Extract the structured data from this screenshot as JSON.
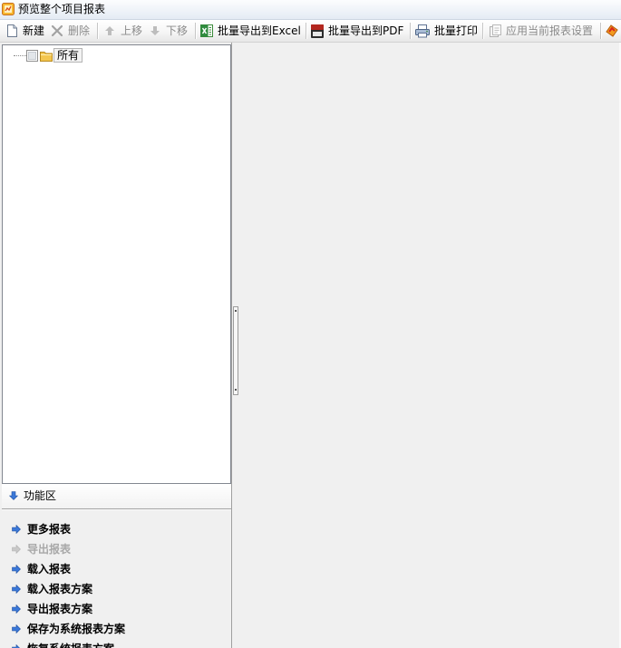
{
  "window": {
    "title": "预览整个项目报表",
    "icon": "report-app-icon"
  },
  "toolbar": {
    "buttons": [
      {
        "label": "新建",
        "icon": "new-document-icon",
        "enabled": true
      },
      {
        "label": "删除",
        "icon": "delete-icon",
        "enabled": false
      },
      {
        "label": "上移",
        "icon": "move-up-icon",
        "enabled": false
      },
      {
        "label": "下移",
        "icon": "move-down-icon",
        "enabled": false
      },
      {
        "label": "批量导出到Excel",
        "icon": "excel-icon",
        "enabled": true
      },
      {
        "label": "批量导出到PDF",
        "icon": "pdf-icon",
        "enabled": true
      },
      {
        "label": "批量打印",
        "icon": "printer-icon",
        "enabled": true
      },
      {
        "label": "应用当前报表设置",
        "icon": "apply-settings-icon",
        "enabled": false
      }
    ],
    "overflow_icon": "toolbar-more-icon"
  },
  "tree": {
    "nodes": [
      {
        "label": "所有",
        "checked": false,
        "selected": true,
        "icon": "folder-icon"
      }
    ]
  },
  "function_area": {
    "header": "功能区",
    "header_icon": "arrow-down-icon",
    "item_icon": "arrow-right-icon",
    "items": [
      {
        "label": "更多报表",
        "enabled": true
      },
      {
        "label": "导出报表",
        "enabled": false
      },
      {
        "label": "载入报表",
        "enabled": true
      },
      {
        "label": "载入报表方案",
        "enabled": true
      },
      {
        "label": "导出报表方案",
        "enabled": true
      },
      {
        "label": "保存为系统报表方案",
        "enabled": true
      },
      {
        "label": "恢复系统报表方案",
        "enabled": true
      }
    ]
  },
  "colors": {
    "window_bg": "#f0f0f0",
    "text": "#000000",
    "disabled_text": "#8a8a8a",
    "disabled_link_text": "#a8a8a8",
    "link_arrow": "#3b78d8",
    "panel_border": "#828790"
  }
}
